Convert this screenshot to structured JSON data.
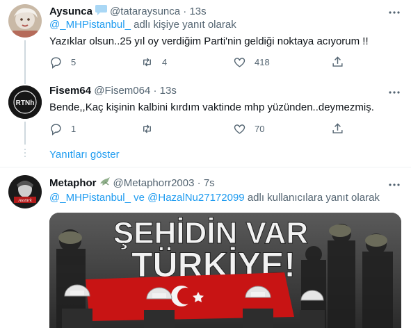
{
  "tweets": [
    {
      "name": "Aysunca",
      "handle": "@tataraysunca",
      "time": "13s",
      "reply_prefix": "",
      "reply_handles": [
        "@_MHPistanbul_"
      ],
      "reply_joiner": "",
      "reply_suffix": "adlı kişiye yanıt olarak",
      "text": "Yazıklar olsun..25 yıl oy verdiğim Parti'nin geldiği noktaya acıyorum !!",
      "replies": "5",
      "retweets": "4",
      "likes": "418"
    },
    {
      "name": "Fisem64",
      "handle": "@Fisem064",
      "time": "13s",
      "avatar_text": "RTNh",
      "text": "Bende,,Kaç kişinin kalbini kırdım vaktinde mhp yüzünden..deymezmiş.",
      "replies": "1",
      "retweets": "",
      "likes": "70"
    },
    {
      "name": "Metaphor",
      "handle": "@Metaphorr2003",
      "time": "7s",
      "avatar_text": "Atatürk",
      "reply_handles": [
        "@_MHPistanbul_",
        "@HazalNu27172099"
      ],
      "reply_joiner": "ve",
      "reply_suffix": "adlı kullanıcılara yanıt olarak",
      "media_lines": [
        "ŞEHİDİN VAR",
        "TÜRKİYE!"
      ]
    }
  ],
  "show_replies": "Yanıtları göster",
  "colors": {
    "link": "#1d9bf0",
    "muted": "#536471",
    "text": "#0f1419",
    "verified": "#1d9bf0"
  },
  "icons": {
    "reply": "reply-icon",
    "retweet": "retweet-icon",
    "like": "heart-icon",
    "share": "share-icon",
    "more": "more-icon",
    "verified": "verified-badge-icon",
    "dove": "dove-icon"
  }
}
